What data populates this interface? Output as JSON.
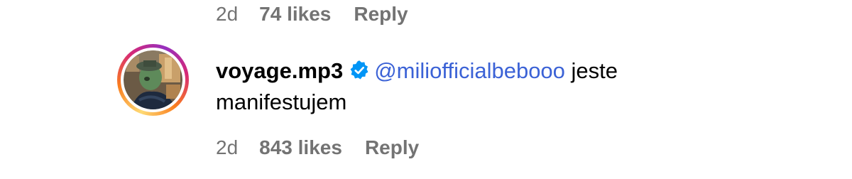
{
  "previous_comment": {
    "time": "2d",
    "likes": "74 likes",
    "reply_label": "Reply"
  },
  "comment": {
    "username": "voyage.mp3",
    "verified_icon": "verified-badge-icon",
    "mention": "@miliofficialbebooo",
    "text_line1": " jeste",
    "text_line2": "manifestujem",
    "time": "2d",
    "likes": "843 likes",
    "reply_label": "Reply"
  },
  "colors": {
    "meta_gray": "#737373",
    "mention_blue": "#3b62d6",
    "verified_blue": "#0095f6"
  }
}
